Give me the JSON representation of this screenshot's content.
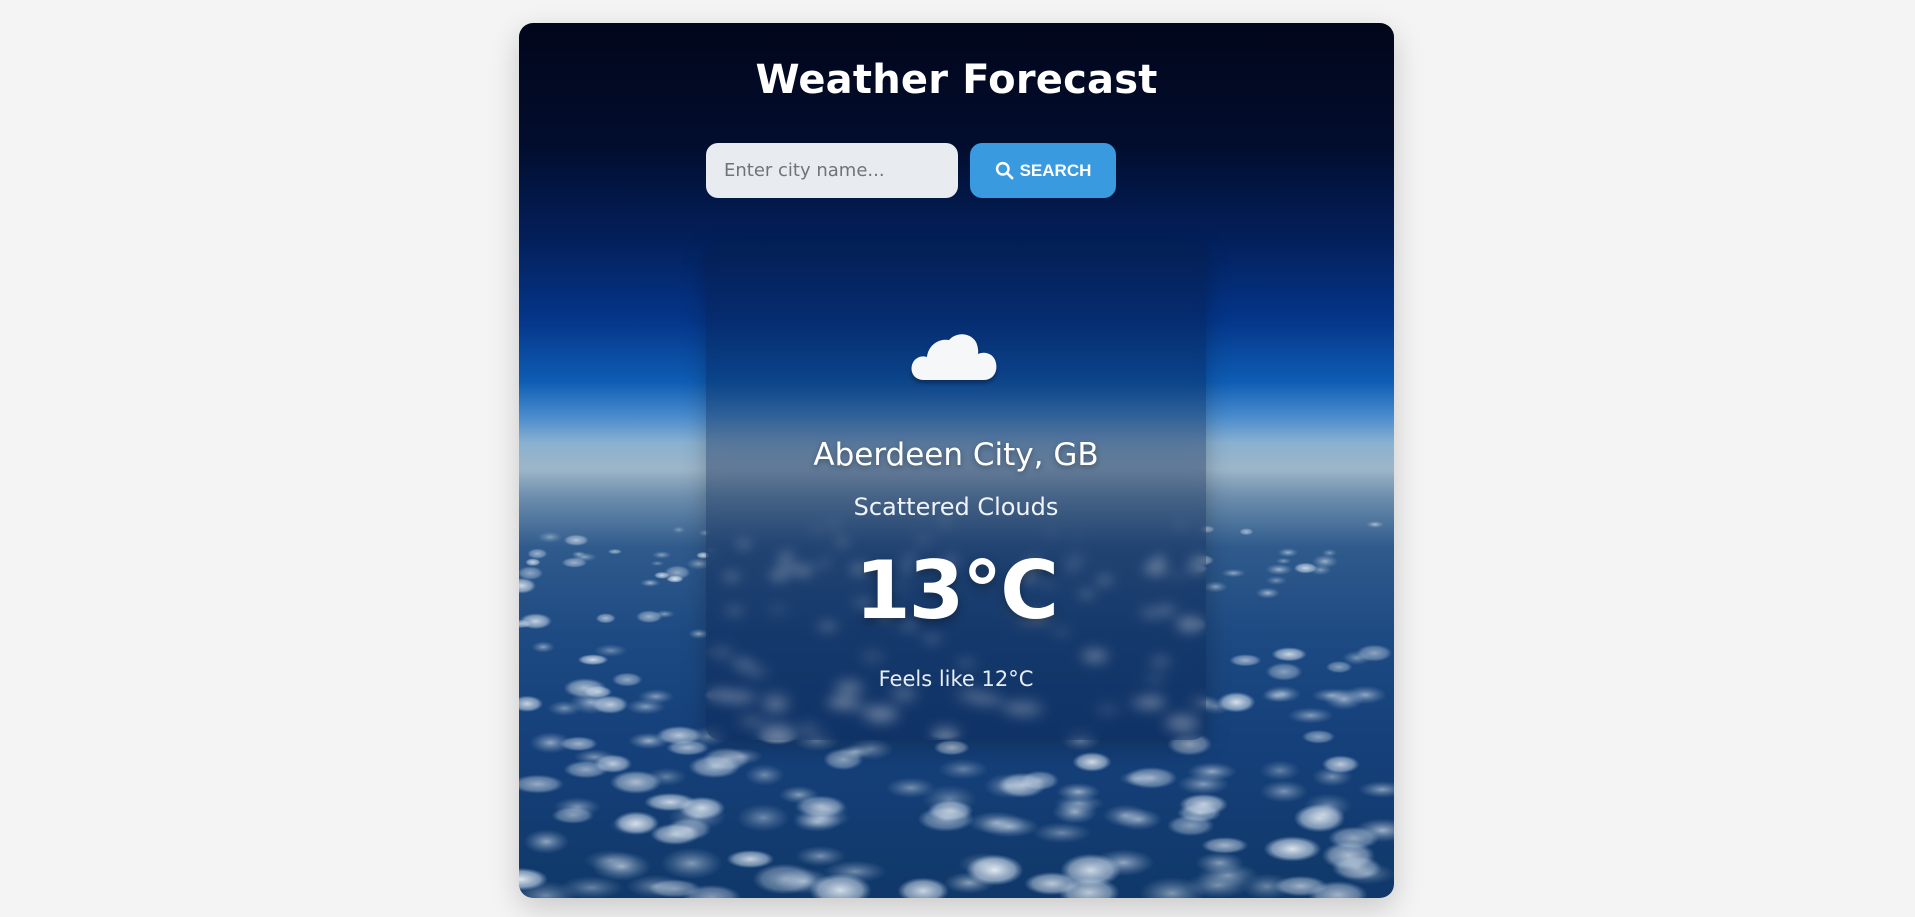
{
  "app": {
    "title": "Weather Forecast"
  },
  "search": {
    "placeholder": "Enter city name...",
    "value": "",
    "button_label": "SEARCH",
    "button_icon": "search-icon"
  },
  "weather": {
    "icon": "cloud-icon",
    "location": "Aberdeen City, GB",
    "condition": "Scattered Clouds",
    "temperature": "13°C",
    "feels_like": "Feels like 12°C"
  },
  "colors": {
    "accent": "#3a9ae0",
    "page_background": "#f4f4f4",
    "text": "#ffffff"
  }
}
